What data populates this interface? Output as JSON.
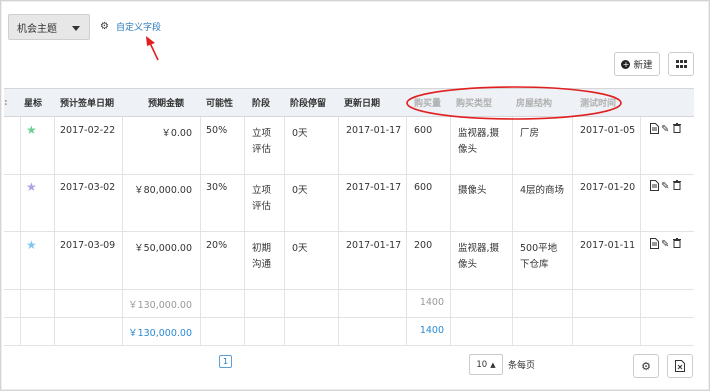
{
  "theme_select": {
    "value": "机会主题"
  },
  "custom_field": {
    "label": "自定义字段",
    "icon": "gear-icon"
  },
  "toolbar": {
    "new_label": "新建",
    "new_icon": "plus-circle-icon",
    "columns_icon": "columns-icon"
  },
  "table": {
    "headers": {
      "star": "星标",
      "expected_date": "预计签单日期",
      "amount": "预期金额",
      "probability": "可能性",
      "stage": "阶段",
      "stage_stay": "阶段停留",
      "updated": "更新日期",
      "purchase_qty": "购买量",
      "purchase_type": "购买类型",
      "building": "房屋结构",
      "test_time": "测试时间"
    },
    "rows": [
      {
        "star_color": "#6fcf97",
        "expected_date": "2017-02-22",
        "amount": "￥0.00",
        "probability": "50%",
        "stage_l1": "立项",
        "stage_l2": "评估",
        "stage_stay": "0天",
        "updated": "2017-01-17",
        "purchase_qty": "600",
        "purchase_type_l1": "监视器,摄",
        "purchase_type_l2": "像头",
        "building_l1": "厂房",
        "building_l2": "",
        "test_time": "2017-01-05"
      },
      {
        "star_color": "#a8a4e6",
        "expected_date": "2017-03-02",
        "amount": "￥80,000.00",
        "probability": "30%",
        "stage_l1": "立项",
        "stage_l2": "评估",
        "stage_stay": "0天",
        "updated": "2017-01-17",
        "purchase_qty": "600",
        "purchase_type_l1": "摄像头",
        "purchase_type_l2": "",
        "building_l1": "4层的商场",
        "building_l2": "",
        "test_time": "2017-01-20"
      },
      {
        "star_color": "#7ec8f0",
        "expected_date": "2017-03-09",
        "amount": "￥50,000.00",
        "probability": "20%",
        "stage_l1": "初期",
        "stage_l2": "沟通",
        "stage_stay": "0天",
        "updated": "2017-01-17",
        "purchase_qty": "200",
        "purchase_type_l1": "监视器,摄",
        "purchase_type_l2": "像头",
        "building_l1": "500平地",
        "building_l2": "下仓库",
        "test_time": "2017-01-11"
      }
    ],
    "row_actions": [
      "document-icon",
      "edit-icon",
      "trash-icon"
    ],
    "subtotal": {
      "amount": "￥130,000.00",
      "purchase_qty": "1400"
    },
    "total": {
      "amount": "￥130,000.00",
      "purchase_qty": "1400"
    }
  },
  "pager": {
    "current_page": "1",
    "per_page": "10",
    "per_page_label": "条每页"
  },
  "colors": {
    "annotation_red": "#e02020",
    "link_blue": "#2a8ad4",
    "header_bg": "#eef1f5"
  }
}
